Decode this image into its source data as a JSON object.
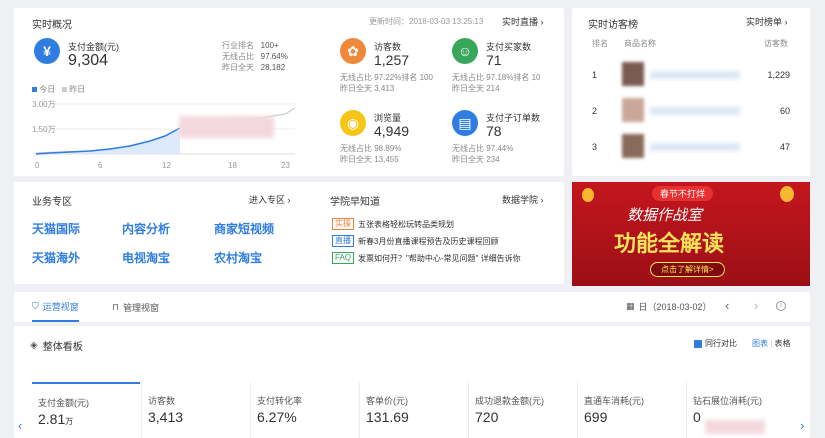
{
  "realtime": {
    "title": "实时概况",
    "update_label": "更新时间：2018-03-03 13:25:13",
    "live_link": "实时直播",
    "pay_amount": {
      "label": "支付金额(元)",
      "value": "9,304",
      "rank_label": "行业排名",
      "rank_value": "100+",
      "wireless_label": "无线占比",
      "wireless_value": "97.64%",
      "yesterday_label": "昨日全天",
      "yesterday_value": "28,182"
    },
    "legend_today": "今日",
    "legend_yesterday": "昨日",
    "y_ticks": [
      "3.00万",
      "1.50万"
    ],
    "x_ticks": [
      "0",
      "6",
      "12",
      "18",
      "23"
    ],
    "visitors": {
      "label": "访客数",
      "value": "1,257",
      "line1": "无线占比  97.22%排名  100",
      "line2": "昨日全天  3,413"
    },
    "buyers": {
      "label": "支付买家数",
      "value": "71",
      "line1": "无线占比  97.18%排名  10",
      "line2": "昨日全天  214"
    },
    "pageviews": {
      "label": "浏览量",
      "value": "4,949",
      "line1": "无线占比  98.89%",
      "line2": "昨日全天  13,455"
    },
    "orders": {
      "label": "支付子订单数",
      "value": "78",
      "line1": "无线占比  97.44%",
      "line2": "昨日全天  234"
    }
  },
  "ranking": {
    "title": "实时访客榜",
    "link": "实时榜单",
    "col_rank": "排名",
    "col_name": "商品名称",
    "col_visitors": "访客数",
    "rows": [
      {
        "rank": "1",
        "visitors": "1,229"
      },
      {
        "rank": "2",
        "visitors": "60"
      },
      {
        "rank": "3",
        "visitors": "47"
      }
    ]
  },
  "business": {
    "title": "业务专区",
    "link": "进入专区",
    "items": [
      "天猫国际",
      "内容分析",
      "商家短视频",
      "天猫海外",
      "电视淘宝",
      "农村淘宝"
    ]
  },
  "news": {
    "title": "学院早知道",
    "link": "数据学院",
    "items": [
      {
        "tag": "实操",
        "tag_color": "#e8833a",
        "text": "五张表格轻松玩转品类规划"
      },
      {
        "tag": "直播",
        "tag_color": "#2f7de1",
        "text": "新春3月份直播课程预告及历史课程回顾"
      },
      {
        "tag": "FAQ",
        "tag_color": "#3aa65a",
        "text": "发票如何开？\"帮助中心-常见问题\" 详细告诉你"
      }
    ]
  },
  "banner": {
    "top": "春节不打烊",
    "line1": "数据作战室",
    "line2": "功能全解读",
    "button": "点击了解详情>"
  },
  "tabs": {
    "ops": "运营视窗",
    "manage": "管理视窗",
    "date_label": "日（2018-03-02）"
  },
  "board": {
    "title": "整体看板",
    "compare_label": "同行对比",
    "view_chart": "图表",
    "view_table": "表格",
    "metrics": [
      {
        "label": "支付金额(元)",
        "value": "2.81",
        "unit": "万"
      },
      {
        "label": "访客数",
        "value": "3,413",
        "unit": ""
      },
      {
        "label": "支付转化率",
        "value": "6.27%",
        "unit": ""
      },
      {
        "label": "客单价(元)",
        "value": "131.69",
        "unit": ""
      },
      {
        "label": "成功退款金额(元)",
        "value": "720",
        "unit": ""
      },
      {
        "label": "直通车消耗(元)",
        "value": "699",
        "unit": ""
      },
      {
        "label": "钻石展位消耗(元)",
        "value": "0",
        "unit": ""
      }
    ]
  },
  "colors": {
    "accent": "#2f7de1",
    "orange": "#f0883a",
    "green": "#3aa65a",
    "yellow": "#f5c518",
    "banner_red": "#b8161d"
  }
}
